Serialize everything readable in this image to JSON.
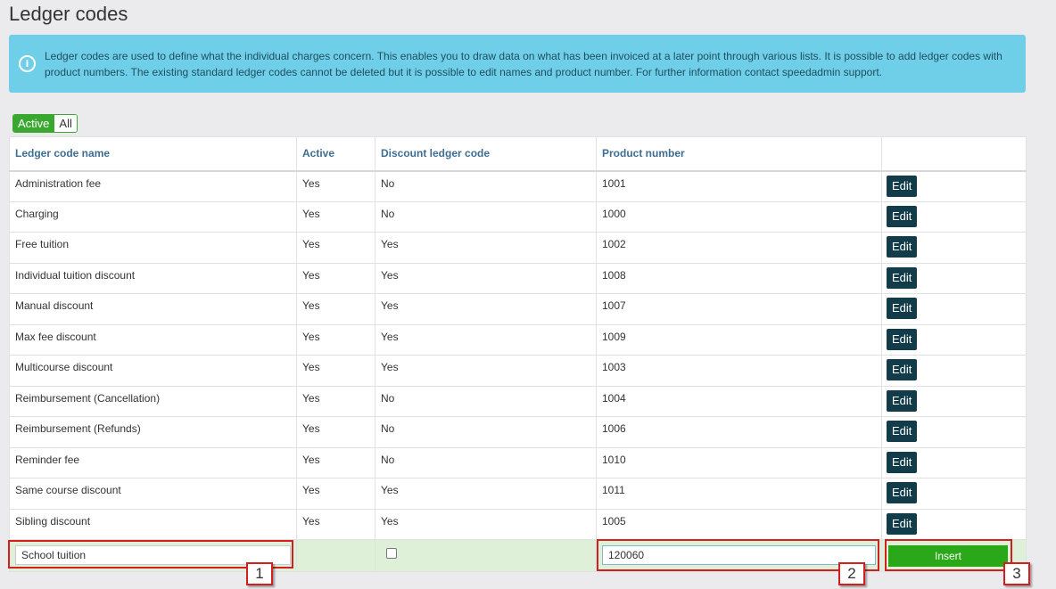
{
  "page": {
    "title": "Ledger codes",
    "info_text": "Ledger codes are used to define what the individual charges concern. This enables you to draw data on what has been invoiced at a later point through various lists. It is possible to add ledger codes with product numbers. The existing standard ledger codes cannot be deleted but it is possible to edit names and product number. For further information contact speedadmin support."
  },
  "filter": {
    "active_label": "Active",
    "all_label": "All"
  },
  "table": {
    "headers": [
      "Ledger code name",
      "Active",
      "Discount ledger code",
      "Product number",
      ""
    ],
    "rows": [
      {
        "name": "Administration fee",
        "active": "Yes",
        "discount": "No",
        "product": "1001"
      },
      {
        "name": "Charging",
        "active": "Yes",
        "discount": "No",
        "product": "1000"
      },
      {
        "name": "Free tuition",
        "active": "Yes",
        "discount": "Yes",
        "product": "1002"
      },
      {
        "name": "Individual tuition discount",
        "active": "Yes",
        "discount": "Yes",
        "product": "1008"
      },
      {
        "name": "Manual discount",
        "active": "Yes",
        "discount": "Yes",
        "product": "1007"
      },
      {
        "name": "Max fee discount",
        "active": "Yes",
        "discount": "Yes",
        "product": "1009"
      },
      {
        "name": "Multicourse discount",
        "active": "Yes",
        "discount": "Yes",
        "product": "1003"
      },
      {
        "name": "Reimbursement (Cancellation)",
        "active": "Yes",
        "discount": "No",
        "product": "1004"
      },
      {
        "name": "Reimbursement (Refunds)",
        "active": "Yes",
        "discount": "No",
        "product": "1006"
      },
      {
        "name": "Reminder fee",
        "active": "Yes",
        "discount": "No",
        "product": "1010"
      },
      {
        "name": "Same course discount",
        "active": "Yes",
        "discount": "Yes",
        "product": "1011"
      },
      {
        "name": "Sibling discount",
        "active": "Yes",
        "discount": "Yes",
        "product": "1005"
      }
    ],
    "edit_label": "Edit"
  },
  "insert_row": {
    "name_value": "School tuition",
    "discount_checked": false,
    "product_value": "120060",
    "insert_label": "Insert"
  },
  "callouts": [
    "1",
    "2",
    "3"
  ],
  "colors": {
    "info_bg": "#6fcfe9",
    "header_text": "#3e6d92",
    "edit_button": "#123c4a",
    "insert_button": "#2aa81a",
    "insert_row_bg": "#dff0d8",
    "callout_border": "#d21f1f"
  }
}
